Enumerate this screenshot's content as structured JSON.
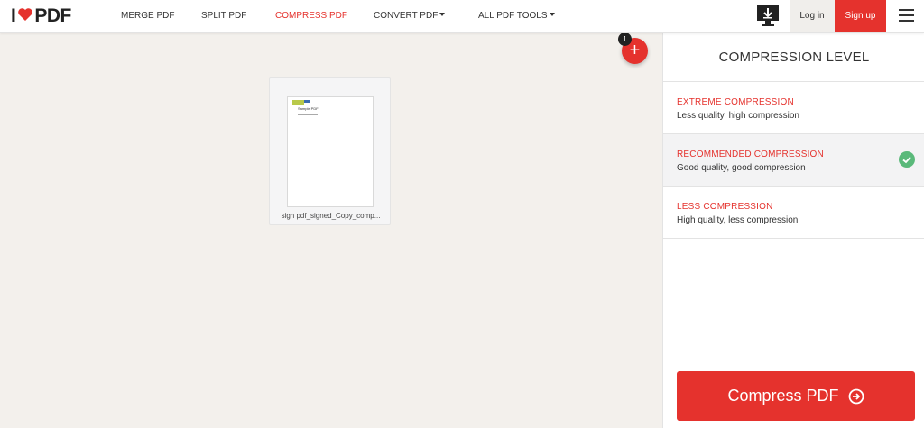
{
  "header": {
    "logo": {
      "prefix": "I",
      "suffix": "PDF"
    },
    "nav": [
      {
        "label": "MERGE PDF",
        "active": false
      },
      {
        "label": "SPLIT PDF",
        "active": false
      },
      {
        "label": "COMPRESS PDF",
        "active": true
      },
      {
        "label": "CONVERT PDF",
        "active": false,
        "has_dropdown": true
      },
      {
        "label": "ALL PDF TOOLS",
        "active": false,
        "has_dropdown": true
      }
    ],
    "desktop_icon": "desktop-download-icon",
    "login_label": "Log in",
    "signup_label": "Sign up",
    "menu_icon": "hamburger-menu-icon"
  },
  "workarea": {
    "files": [
      {
        "name": "sign pdf_signed_Copy_comp...",
        "thumbnail_title": "Sample PDF"
      }
    ],
    "add_button": {
      "icon": "plus-icon",
      "badge": "1"
    }
  },
  "sidebar": {
    "title": "COMPRESSION LEVEL",
    "options": [
      {
        "name": "EXTREME COMPRESSION",
        "description": "Less quality, high compression",
        "selected": false
      },
      {
        "name": "RECOMMENDED COMPRESSION",
        "description": "Good quality, good compression",
        "selected": true
      },
      {
        "name": "LESS COMPRESSION",
        "description": "High quality, less compression",
        "selected": false
      }
    ],
    "action_label": "Compress PDF"
  },
  "colors": {
    "accent": "#e5322d",
    "check": "#5ab97a",
    "background": "#f3f0ec"
  }
}
